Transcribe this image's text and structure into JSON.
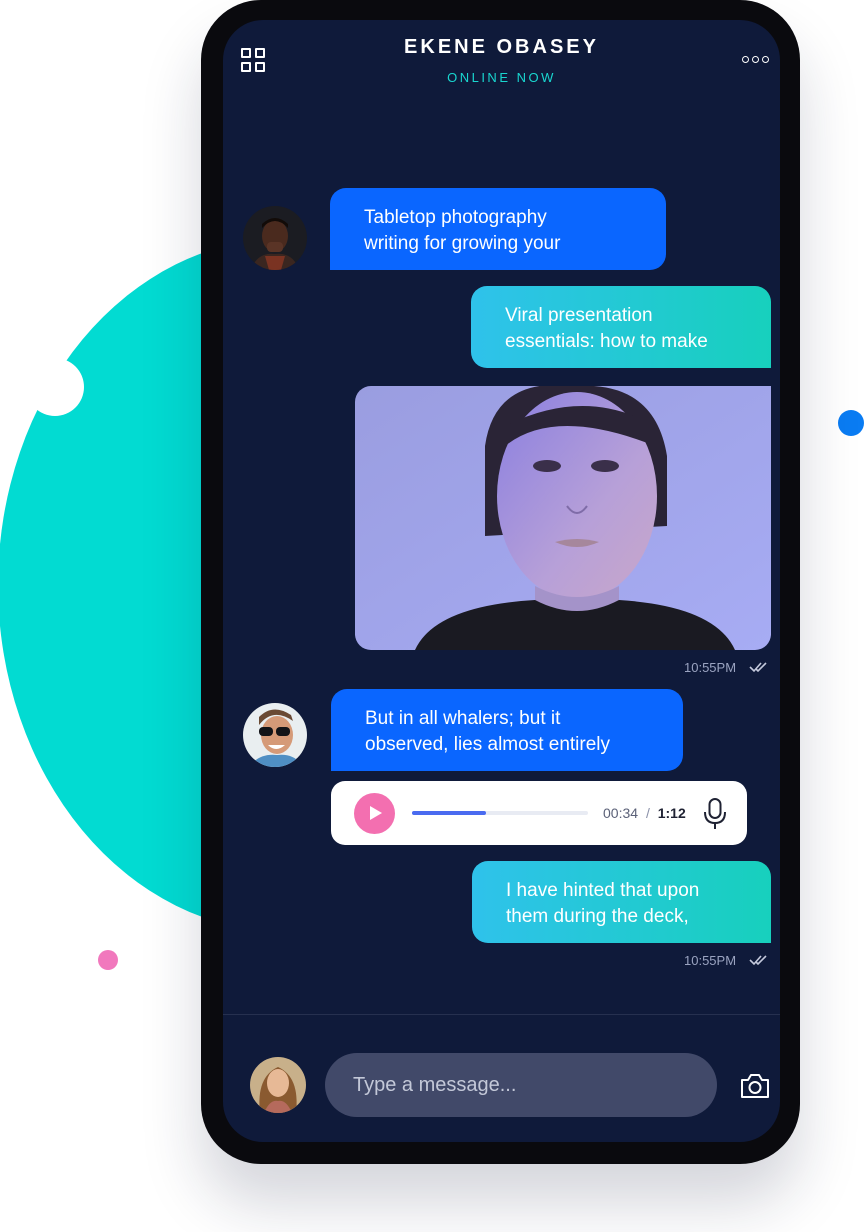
{
  "header": {
    "contact_name": "EKENE OBASEY",
    "status": "ONLINE NOW",
    "menu_icon": "grid-icon",
    "more_icon": "more-horizontal-icon"
  },
  "messages": [
    {
      "from": "contact",
      "lines": [
        "Tabletop photography",
        "writing for growing your"
      ]
    },
    {
      "from": "me",
      "lines": [
        "Viral presentation",
        "essentials: how to make"
      ]
    },
    {
      "from": "me",
      "type": "image",
      "time": "10:55PM"
    },
    {
      "from": "contact",
      "lines": [
        "But in all whalers; but it",
        "observed, lies almost entirely"
      ]
    },
    {
      "from": "contact",
      "type": "audio",
      "elapsed": "00:34",
      "separator": "/",
      "duration": "1:12",
      "progress": 0.42
    },
    {
      "from": "me",
      "lines": [
        "I have hinted that upon",
        "them during the deck,"
      ],
      "time": "10:55PM"
    }
  ],
  "composer": {
    "placeholder": "Type a message...",
    "camera_icon": "camera-icon"
  },
  "colors": {
    "background_shape": "#02dbd2",
    "screen": "#0f1a3a",
    "incoming_bubble": "#0a66ff",
    "outgoing_bubble": "#17d0bd",
    "status_text": "#19d6cf",
    "play_button": "#f36fb0",
    "accent_dot_blue": "#0a7cf3",
    "accent_dot_pink": "#f178bd"
  }
}
